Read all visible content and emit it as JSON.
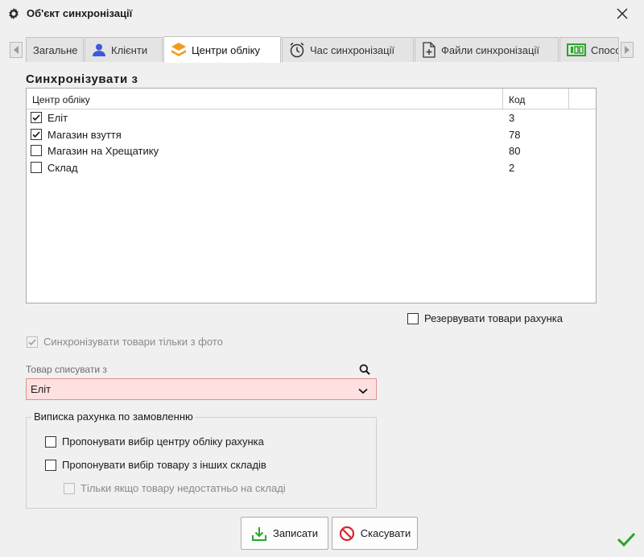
{
  "window": {
    "title": "Об'єкт синхронізації"
  },
  "tabs": [
    {
      "label": "Загальне",
      "active": false
    },
    {
      "label": "Клієнти",
      "active": false,
      "icon": "user-icon"
    },
    {
      "label": "Центри обліку",
      "active": true,
      "icon": "layers-icon"
    },
    {
      "label": "Час синхронізації",
      "active": false,
      "icon": "clock-icon"
    },
    {
      "label": "Файли синхронізації",
      "active": false,
      "icon": "file-plus-icon"
    },
    {
      "label": "Спосо",
      "active": false,
      "icon": "counter-icon"
    }
  ],
  "sync_section": {
    "title": "Синхронізувати з",
    "columns": {
      "center": "Центр обліку",
      "code": "Код"
    },
    "rows": [
      {
        "name": "Еліт",
        "code": "3",
        "checked": true
      },
      {
        "name": "Магазин взуття",
        "code": "78",
        "checked": true
      },
      {
        "name": "Магазин на Хрещатику",
        "code": "80",
        "checked": false
      },
      {
        "name": "Склад",
        "code": "2",
        "checked": false
      }
    ]
  },
  "options": {
    "reserve_goods": {
      "label": "Резервувати товари рахунка",
      "checked": false
    },
    "sync_with_photo": {
      "label": "Синхронізувати товари тільки з фото",
      "checked": true,
      "disabled": true
    }
  },
  "writeoff": {
    "label": "Товар списувати з",
    "value": "Еліт"
  },
  "invoice_group": {
    "legend": "Виписка рахунка по замовленню",
    "offer_center": {
      "label": "Пропонувати вибір центру обліку рахунка",
      "checked": false
    },
    "offer_other": {
      "label": "Пропонувати вибір товару з інших складів",
      "checked": false
    },
    "only_if_insufficient": {
      "label": "Тільки якщо товару недостатньо на складі",
      "checked": false,
      "disabled": true
    }
  },
  "buttons": {
    "save": "Записати",
    "cancel": "Скасувати"
  },
  "colors": {
    "accent_green": "#2aa52a",
    "cancel_red": "#d9262c",
    "error_field_bg": "#ffe0e0",
    "tab_icon_orange": "#f29a1f",
    "user_icon_blue": "#3d5bd9"
  }
}
